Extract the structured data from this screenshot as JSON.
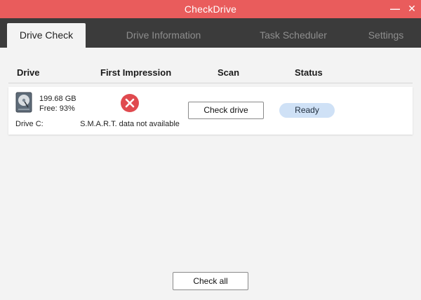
{
  "window": {
    "title": "CheckDrive",
    "minimize_glyph": "—",
    "close_glyph": "✕"
  },
  "tabs": [
    {
      "label": "Drive Check",
      "active": true
    },
    {
      "label": "Drive Information",
      "active": false
    },
    {
      "label": "Task Scheduler",
      "active": false
    },
    {
      "label": "Settings",
      "active": false
    }
  ],
  "table": {
    "columns": [
      "Drive",
      "First Impression",
      "Scan",
      "Status"
    ],
    "rows": [
      {
        "icon": "hard-drive-icon",
        "size": "199.68 GB",
        "free": "Free: 93%",
        "drive": "Drive C:",
        "impression_icon": "error-x-icon",
        "impression_text": "S.M.A.R.T. data not available",
        "scan_button": "Check drive",
        "status": "Ready"
      }
    ]
  },
  "footer": {
    "check_all_button": "Check all"
  },
  "colors": {
    "titlebar": "#e95c5c",
    "tabbar": "#3b3b3b",
    "error": "#e04a4f",
    "status_pill": "#cfe1f6"
  }
}
